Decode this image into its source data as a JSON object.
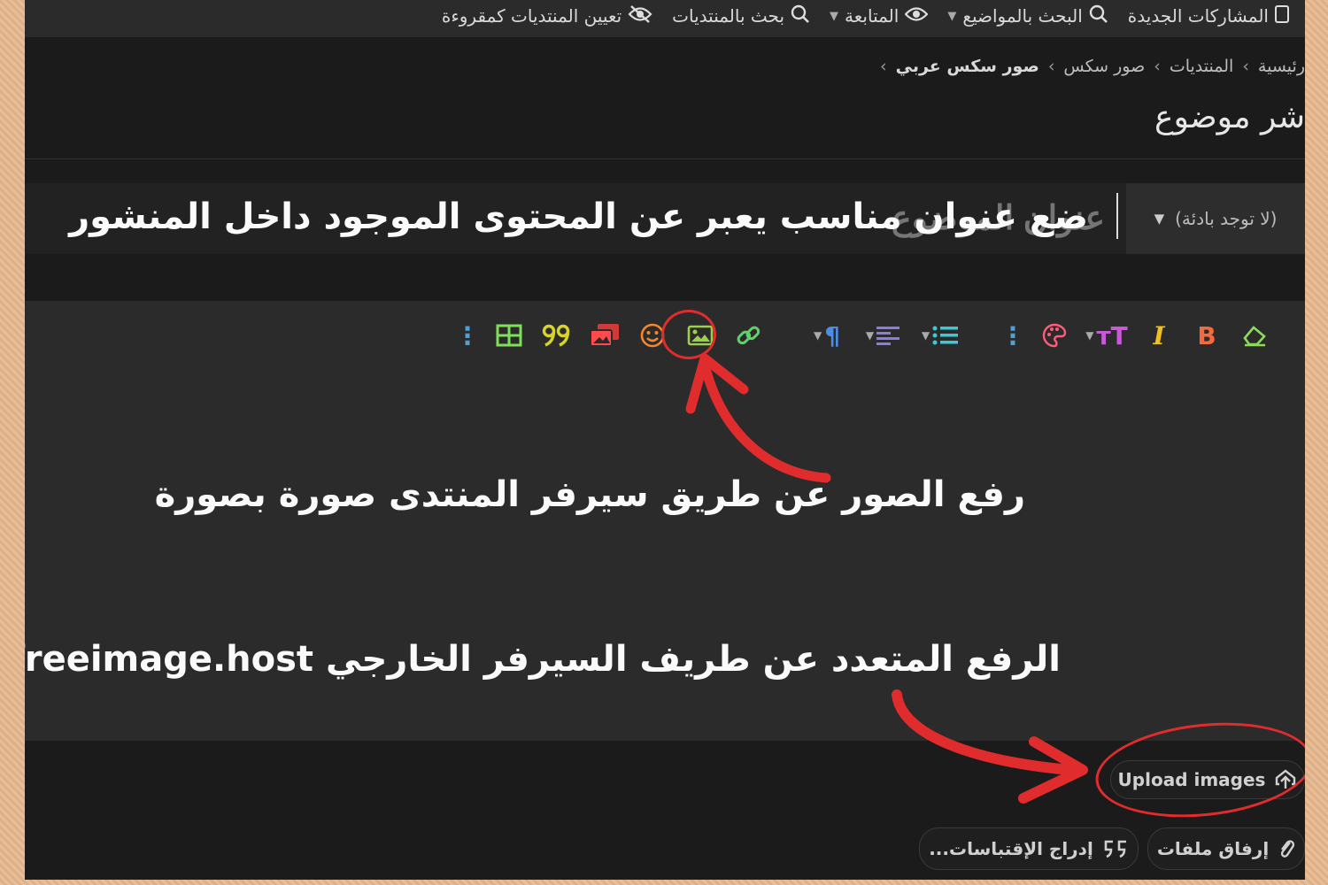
{
  "nav": {
    "items": [
      {
        "label": "المشاركات الجديدة",
        "icon": "document-icon"
      },
      {
        "label": "البحث بالمواضيع",
        "icon": "search-icon"
      },
      {
        "label": "المتابعة",
        "icon": "eye-icon"
      },
      {
        "label": "بحث بالمنتديات",
        "icon": "search-icon"
      },
      {
        "label": "تعيين المنتديات كمقروءة",
        "icon": "eye-slash-icon"
      }
    ]
  },
  "breadcrumb": [
    "رئيسية",
    "المنتديات",
    "صور سكس",
    "صور سكس عربي"
  ],
  "page": {
    "title": "شر موضوع"
  },
  "title_field": {
    "prefix_label": "(لا توجد بادئة)",
    "placeholder": "عنوان الموضوع"
  },
  "toolbar": {
    "bold": "B",
    "italic": "I",
    "textsize": "тT",
    "paragraph": "¶"
  },
  "annotations": {
    "title_hint": "ضع عنوان مناسب يعبر عن المحتوى الموجود داخل المنشور",
    "image_hint": "رفع الصور عن طريق سيرفر المنتدى صورة بصورة",
    "upload_hint": "الرفع المتعدد عن طريف السيرفر الخارجي freeimage.host"
  },
  "footer": {
    "upload_images": "Upload images",
    "attach_files": "إرفاق ملفات",
    "insert_quotes": "إدراج الإقتباسات..."
  },
  "colors": {
    "annotation_red": "#e02c2c",
    "panel": "#2b2b2b",
    "background": "#1b1b1b"
  }
}
